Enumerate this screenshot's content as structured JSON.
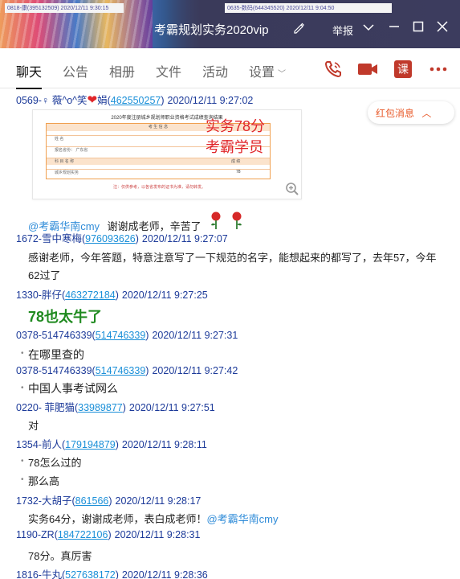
{
  "window": {
    "title": "考霸规划实务2020vip",
    "report_label": "举报",
    "bg_tabs": [
      "0818-康(395132509) 2020/12/11 9:30:15",
      "0635-数码(644345520) 2020/12/11 9:04:50"
    ]
  },
  "tabs": [
    {
      "label": "聊天",
      "active": true
    },
    {
      "label": "公告"
    },
    {
      "label": "相册"
    },
    {
      "label": "文件"
    },
    {
      "label": "活动"
    },
    {
      "label": "设置"
    }
  ],
  "toolbar_icons": [
    "phone-icon",
    "video-icon",
    "lesson-icon",
    "more-icon"
  ],
  "lesson_label": "课",
  "redpack_label": "红包消息",
  "certificate": {
    "title": "2020年度注册城乡规划师职业资格考试成绩查询结果",
    "section_label": "考 生 信 息",
    "rows": [
      "姓  名",
      "报名省份：   广东省",
      "科  目  名  称",
      "城乡规划实务"
    ],
    "score_header": "成  绩",
    "score": "78",
    "foot": "注：仅供参考，以各省发布的证书为准，请勿转发。",
    "annotation_line1": "实务78分",
    "annotation_line2": "考霸学员"
  },
  "messages": [
    {
      "sender": "0569-",
      "sender_decor": "♀ 薇^o^笑",
      "sender_tail": "娟",
      "qq": "462550257",
      "time": "2020/12/11 9:27:02"
    },
    {
      "mention": "@考霸华南cmy",
      "text": "谢谢成老师，辛苦了"
    },
    {
      "sender": "1672-雪中寒梅",
      "qq": "976093626",
      "time": "2020/12/11 9:27:07"
    },
    {
      "text": "感谢老师，今年答题，特意注意写了一下规范的名字，能想起来的都写了，去年57，今年"
    },
    {
      "text": "62过了"
    },
    {
      "sender": "1330-胖仔",
      "qq": "463272184",
      "time": "2020/12/11 9:27:25"
    },
    {
      "text": "78也太牛了"
    },
    {
      "sender": "0378-514746339",
      "qq": "514746339",
      "time": "2020/12/11 9:27:31"
    },
    {
      "text": "在哪里查的"
    },
    {
      "sender": "0378-514746339",
      "qq": "514746339",
      "time": "2020/12/11 9:27:42"
    },
    {
      "text": "中国人事考试网么"
    },
    {
      "sender": "0220-   菲肥猫",
      "qq": "33989877",
      "time": "2020/12/11 9:27:51"
    },
    {
      "text": "对"
    },
    {
      "sender": "1354-前人",
      "qq": "179194879",
      "time": "2020/12/11 9:28:11"
    },
    {
      "text": "78怎么过的"
    },
    {
      "text": "那么高"
    },
    {
      "sender": "1732-大胡子",
      "qq": "861566",
      "time": "2020/12/11 9:28:17"
    },
    {
      "text": "实务64分，谢谢成老师，表白成老师！",
      "mention": "@考霸华南cmy"
    },
    {
      "sender": "1190-ZR",
      "qq": "184722106",
      "time": "2020/12/11 9:28:31"
    },
    {
      "text": "78分。真厉害"
    },
    {
      "sender": "1816-牛丸",
      "qq": "527638172",
      "time": "2020/12/11 9:28:36"
    }
  ]
}
